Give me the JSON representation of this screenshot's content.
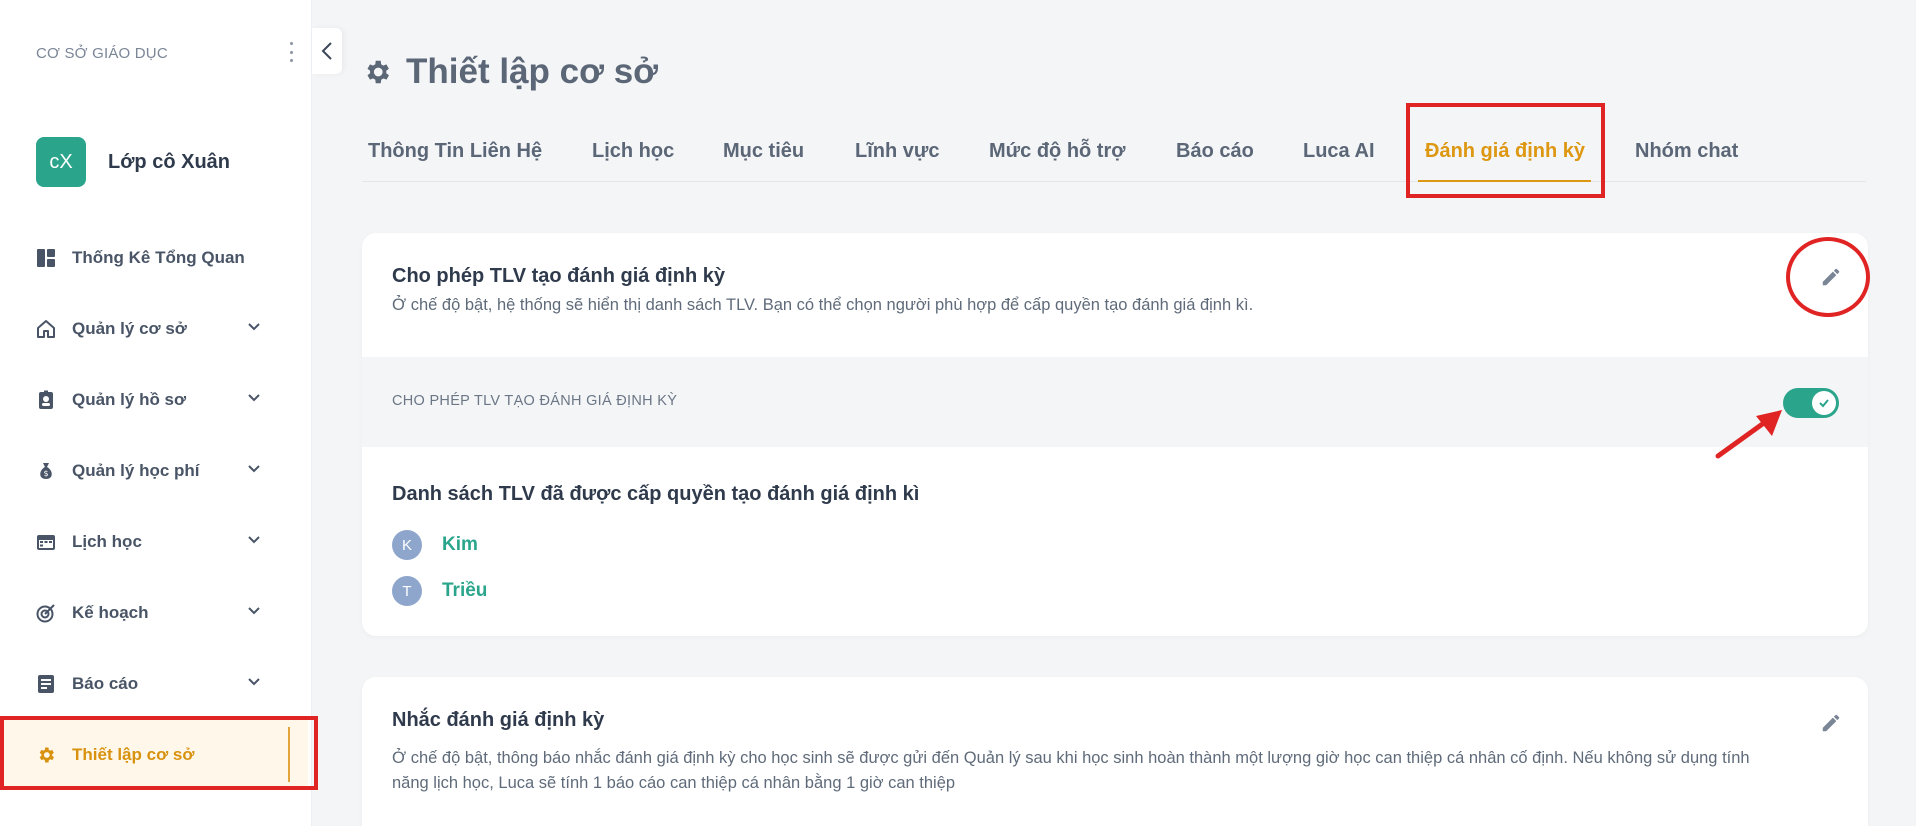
{
  "sidebar": {
    "section_title": "CƠ SỞ GIÁO DỤC",
    "org": {
      "initials": "cX",
      "name": "Lớp cô Xuân"
    },
    "items": [
      {
        "label": "Thống Kê Tổng Quan",
        "icon": "dashboard-icon",
        "has_chevron": false
      },
      {
        "label": "Quản lý cơ sở",
        "icon": "home-icon",
        "has_chevron": true
      },
      {
        "label": "Quản lý hồ sơ",
        "icon": "id-badge-icon",
        "has_chevron": true
      },
      {
        "label": "Quản lý học phí",
        "icon": "money-bag-icon",
        "has_chevron": true
      },
      {
        "label": "Lịch học",
        "icon": "calendar-icon",
        "has_chevron": true
      },
      {
        "label": "Kế hoạch",
        "icon": "target-icon",
        "has_chevron": true
      },
      {
        "label": "Báo cáo",
        "icon": "report-icon",
        "has_chevron": true
      },
      {
        "label": "Thiết lập cơ sở",
        "icon": "gear-icon",
        "has_chevron": false,
        "active": true
      }
    ]
  },
  "page": {
    "title": "Thiết lập cơ sở"
  },
  "tabs": [
    {
      "label": "Thông Tin Liên Hệ"
    },
    {
      "label": "Lịch học"
    },
    {
      "label": "Mục tiêu"
    },
    {
      "label": "Lĩnh vực"
    },
    {
      "label": "Mức độ hỗ trợ"
    },
    {
      "label": "Báo cáo"
    },
    {
      "label": "Luca AI"
    },
    {
      "label": "Đánh giá định kỳ",
      "active": true
    },
    {
      "label": "Nhóm chat"
    }
  ],
  "card1": {
    "title": "Cho phép TLV tạo đánh giá định kỳ",
    "description": "Ở chế độ bật, hệ thống sẽ hiển thị danh sách TLV. Bạn có thể chọn người phù hợp để cấp quyền tạo đánh giá định kì.",
    "toggle_label": "CHO PHÉP TLV TẠO ĐÁNH GIÁ ĐỊNH KỲ",
    "toggle_on": true,
    "list_title": "Danh sách TLV đã được cấp quyền tạo đánh giá định kì",
    "members": [
      {
        "initial": "K",
        "name": "Kim"
      },
      {
        "initial": "T",
        "name": "Triều"
      }
    ]
  },
  "card2": {
    "title": "Nhắc đánh giá định kỳ",
    "description_line1": "Ở chế độ bật, thông báo nhắc đánh giá định kỳ cho học sinh sẽ được gửi đến Quản lý sau khi học sinh hoàn thành một lượng giờ học can thiệp cá nhân cố định. Nếu không sử dụng tính",
    "description_line2": "năng lịch học, Luca sẽ tính 1 báo cáo can thiệp cá nhân bằng 1 giờ can thiệp"
  },
  "colors": {
    "accent": "#2aa58c",
    "active": "#dd9711",
    "highlight": "#e02424"
  }
}
